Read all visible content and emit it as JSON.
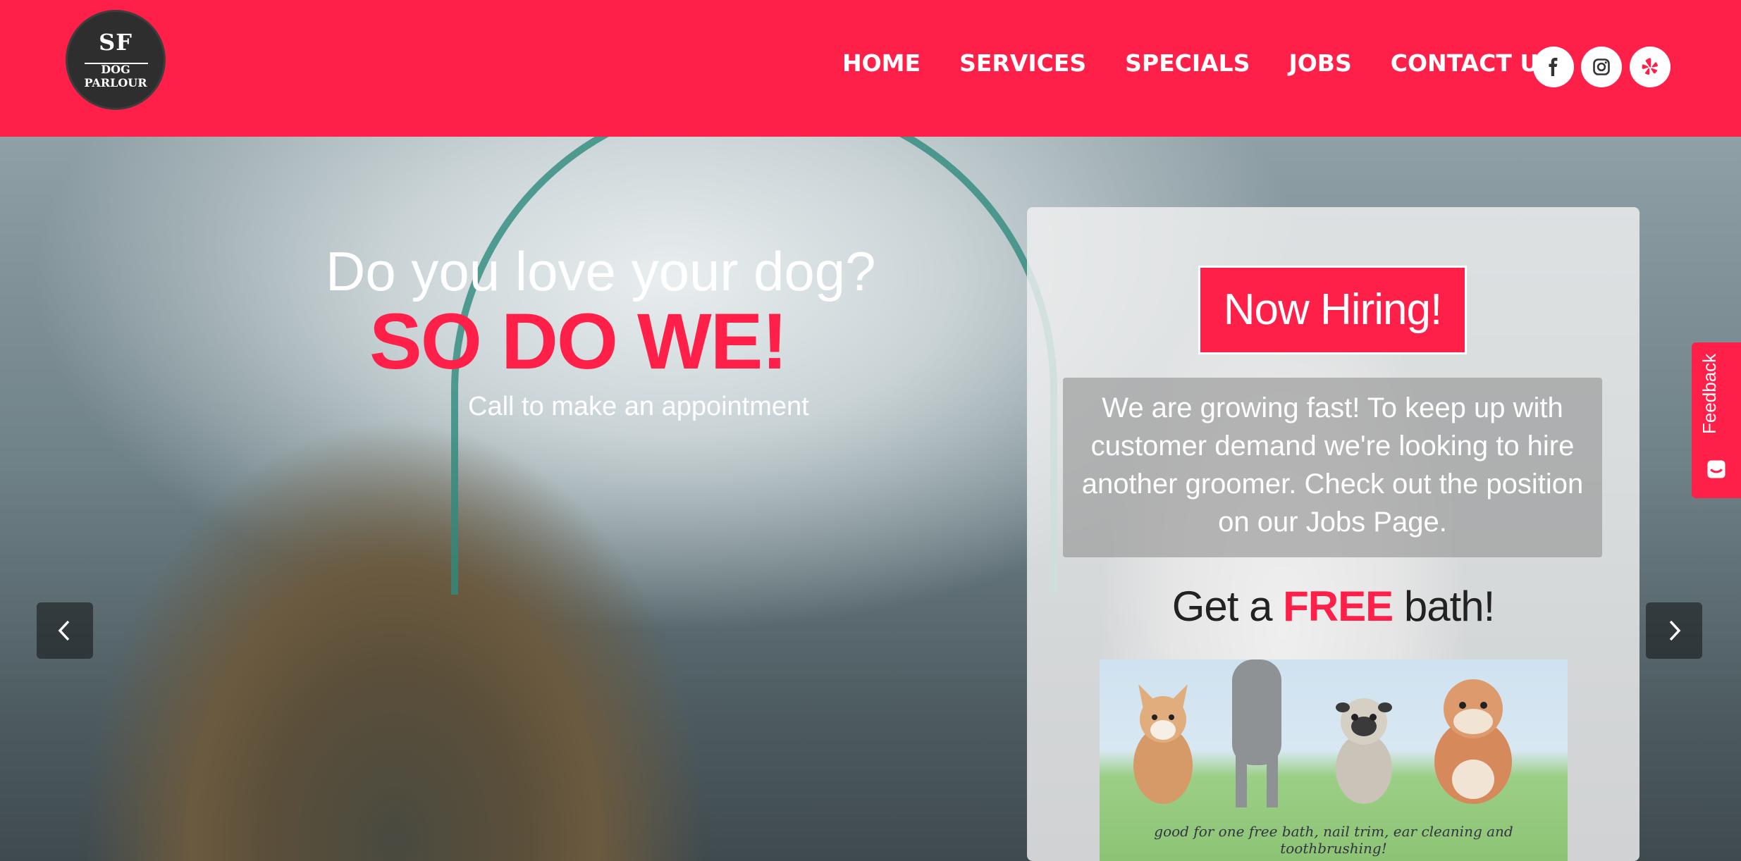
{
  "brand": {
    "logo_top": "SF",
    "logo_bottom": "DOG PARLOUR"
  },
  "nav": {
    "items": [
      "HOME",
      "SERVICES",
      "SPECIALS",
      "JOBS",
      "CONTACT US"
    ]
  },
  "hero": {
    "headline": "Do you love your dog?",
    "emphasis": "SO DO WE!",
    "subtext": "Call to make an appointment"
  },
  "panel": {
    "hiring_button": "Now Hiring!",
    "growing_text": "We are growing fast! To keep up with customer demand we're looking to hire another groomer. Check out the position on our Jobs Page.",
    "free_prefix": "Get a",
    "free_word": "FREE",
    "free_suffix": "bath!",
    "coupon_caption": "good for one free bath, nail trim, ear cleaning and toothbrushing!"
  },
  "feedback": {
    "label": "Feedback"
  },
  "colors": {
    "brand_red": "#ff2049",
    "white": "#ffffff",
    "panel_gray": "#f0f0f0"
  },
  "icons": {
    "social": [
      "facebook-icon",
      "instagram-icon",
      "yelp-icon"
    ],
    "carousel": [
      "chevron-left-icon",
      "chevron-right-icon"
    ]
  }
}
